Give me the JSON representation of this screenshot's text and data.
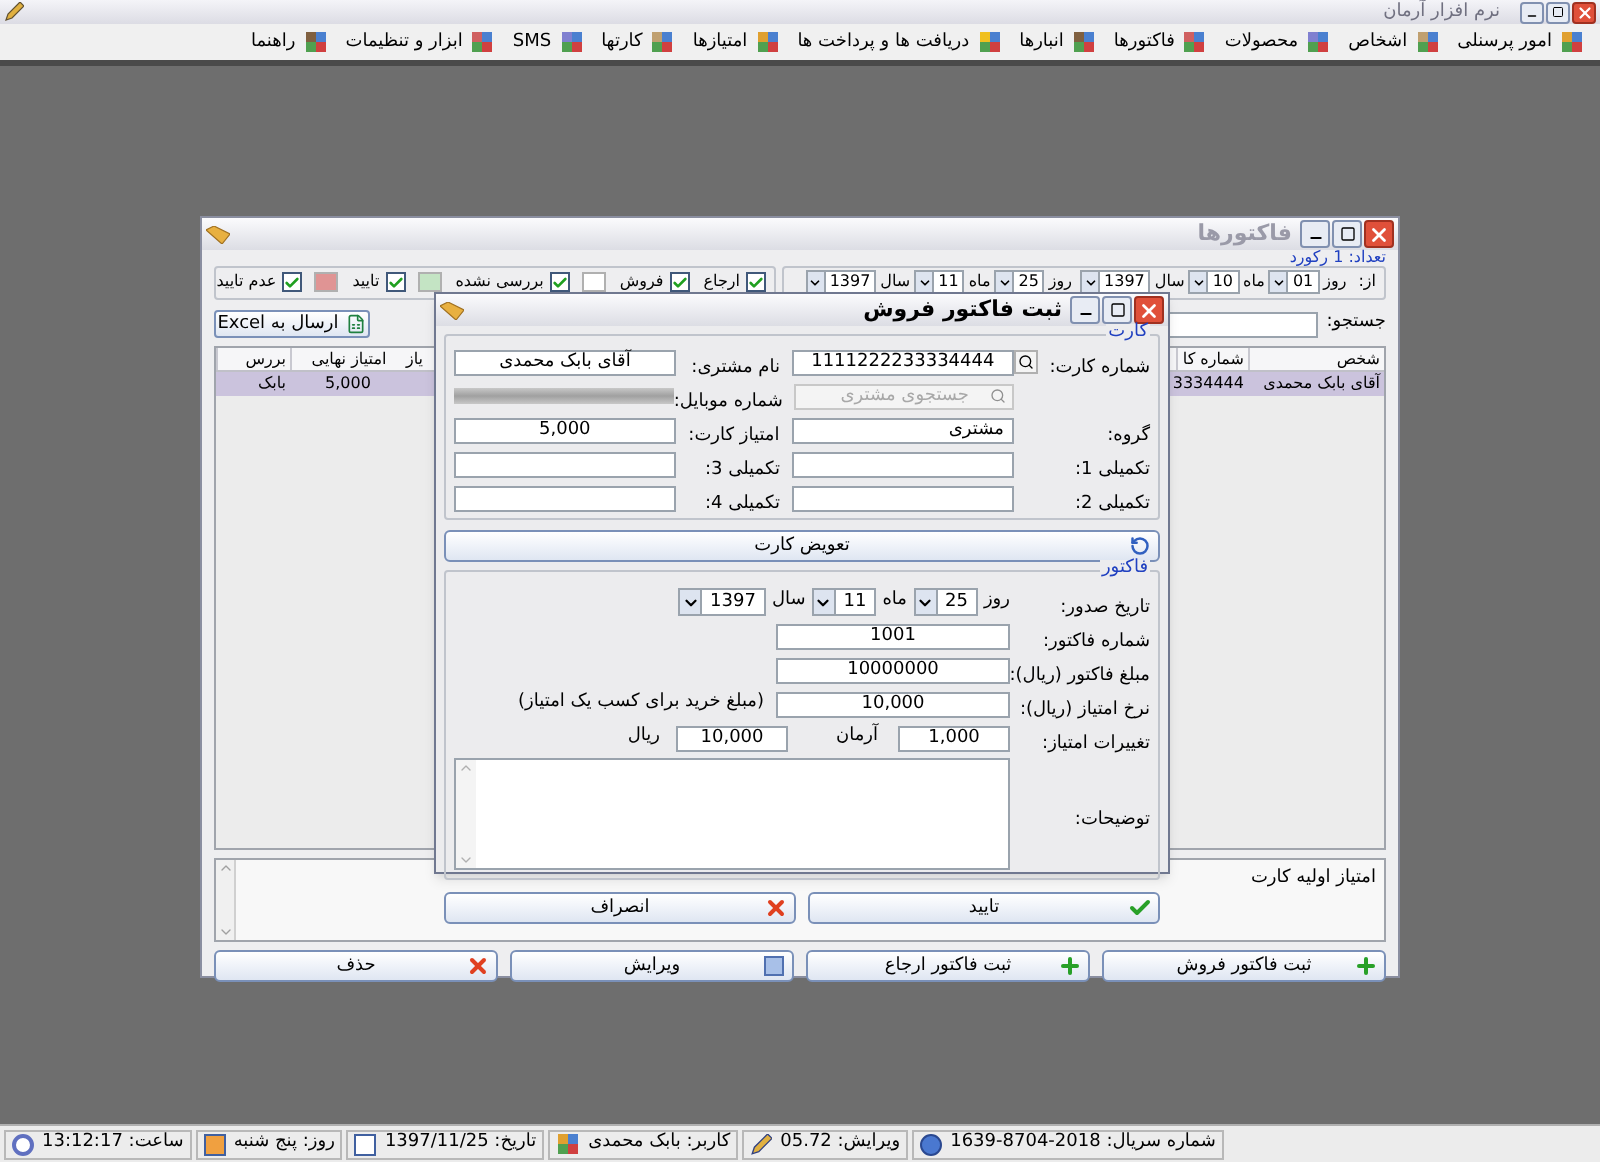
{
  "app_window": {
    "title": "نرم افزار آرمان"
  },
  "menu": [
    {
      "label": "امور پرسنلی"
    },
    {
      "label": "اشخاص"
    },
    {
      "label": "محصولات"
    },
    {
      "label": "فاکتورها"
    },
    {
      "label": "انبارها"
    },
    {
      "label": "دریافت ها و پرداخت ها"
    },
    {
      "label": "امتیازها"
    },
    {
      "label": "کارتها"
    },
    {
      "label": "SMS"
    },
    {
      "label": "ابزار و تنظیمات"
    },
    {
      "label": "راهنما"
    }
  ],
  "invoices_window": {
    "title": "فاکتورها",
    "record_count": "تعداد: 1 رکورد",
    "from_date": {
      "label": "از:",
      "day_label": "روز",
      "day": "01",
      "month_label": "ماه",
      "month": "10",
      "year_label": "سال",
      "year": "1397"
    },
    "to_date": {
      "day_label": "روز",
      "day": "25",
      "month_label": "ماه",
      "month": "11",
      "year_label": "سال",
      "year": "1397"
    },
    "filters": [
      {
        "label": "ارجاع",
        "checked": true
      },
      {
        "label": "فروش",
        "checked": true
      },
      {
        "label": "بررسی نشده",
        "checked": true,
        "color": "#ffffff"
      },
      {
        "label": "تایید",
        "checked": true,
        "color": "#c4e4c4"
      },
      {
        "label": "عدم تایید",
        "checked": true,
        "color": "#e09494"
      }
    ],
    "search_label": "جستجو:",
    "excel_button": "ارسال به Excel",
    "table": {
      "columns": [
        "شخص",
        "شماره کا",
        "یاز",
        "امتیاز نهایی",
        "بررس"
      ],
      "rows": [
        {
          "selected": true,
          "cells": [
            "آقای بابک محمدی",
            "3334444",
            null,
            "5,000",
            "بابک"
          ]
        }
      ]
    },
    "notes": "امتیاز اولیه کارت",
    "buttons": [
      {
        "label": "ثبت فاکتور فروش",
        "kind": "add"
      },
      {
        "label": "ثبت فاکتور ارجاع",
        "kind": "add"
      },
      {
        "label": "ویرایش",
        "kind": "edit"
      },
      {
        "label": "حذف",
        "kind": "delete"
      }
    ]
  },
  "sale_dialog": {
    "title": "ثبت فاکتور فروش",
    "card_group": {
      "title": "کارت",
      "card_number_label": "شماره کارت:",
      "card_number": "1111222233334444",
      "customer_name_label": "نام مشتری:",
      "customer_name": "آقای بابک محمدی",
      "customer_search_placeholder": "جستجوی مشتری",
      "mobile_label": "شماره موبایل:",
      "group_label": "گروه:",
      "group": "مشتری",
      "card_points_label": "امتیاز کارت:",
      "card_points": "5,000",
      "extra_1_label": "تکمیلی 1:",
      "extra_3_label": "تکمیلی 3:",
      "extra_2_label": "تکمیلی 2:",
      "extra_4_label": "تکمیلی 4:"
    },
    "replace_card_button": "تعویض کارت",
    "invoice_group": {
      "title": "فاکتور",
      "issue_date_label": "تاریخ صدور:",
      "day_label": "روز",
      "day": "25",
      "month_label": "ماه",
      "month": "11",
      "year_label": "سال",
      "year": "1397",
      "invoice_number_label": "شماره فاکتور:",
      "invoice_number": "1001",
      "amount_label": "مبلغ فاکتور (ریال):",
      "amount": "10000000",
      "rate_label": "نرخ امتیاز (ریال):",
      "rate": "10,000",
      "rate_hint": "(مبلغ خرید برای کسب یک امتیاز)",
      "change_label": "تغییرات امتیاز:",
      "change_points": "1,000",
      "points_unit": "آرمان",
      "change_rials": "10,000",
      "rials_unit": "ریال",
      "description_label": "توضیحات:"
    },
    "buttons": [
      {
        "label": "تایید",
        "kind": "ok"
      },
      {
        "label": "انصراف",
        "kind": "cancel"
      }
    ]
  },
  "status_bar": [
    {
      "text": "شماره سریال: 2018-8704-1639",
      "kind": "serial"
    },
    {
      "text": "ویرایش: 05.72",
      "kind": "version"
    },
    {
      "text": "کاربر: بابک محمدی",
      "kind": "user"
    },
    {
      "text": "تاریخ: 1397/11/25",
      "kind": "date"
    },
    {
      "text": "روز: پنج شنبه",
      "kind": "day"
    },
    {
      "text": "ساعت: 13:12:17",
      "kind": "time"
    }
  ]
}
